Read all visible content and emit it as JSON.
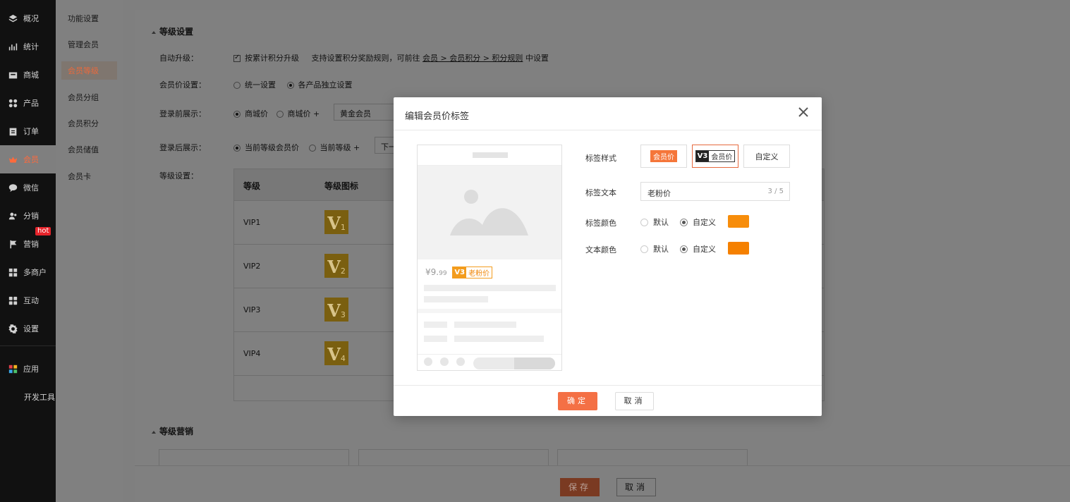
{
  "nav": {
    "items": [
      {
        "label": "概况",
        "icon": "layers-icon"
      },
      {
        "label": "统计",
        "icon": "chart-icon"
      },
      {
        "label": "商城",
        "icon": "store-icon"
      },
      {
        "label": "产品",
        "icon": "grid-icon"
      },
      {
        "label": "订单",
        "icon": "clipboard-icon"
      },
      {
        "label": "会员",
        "icon": "crown-icon",
        "active": true
      },
      {
        "label": "微信",
        "icon": "chat-icon"
      },
      {
        "label": "分销",
        "icon": "users-icon"
      },
      {
        "label": "营销",
        "icon": "flag-icon",
        "badge": "hot"
      },
      {
        "label": "多商户",
        "icon": "shop-icon"
      },
      {
        "label": "互动",
        "icon": "apps-icon"
      },
      {
        "label": "设置",
        "icon": "gear-icon"
      },
      {
        "label": "应用",
        "icon": "colorgrid-icon"
      },
      {
        "label": "开发工具",
        "icon": ""
      }
    ]
  },
  "submenu": {
    "items": [
      "功能设置",
      "管理会员",
      "会员等级",
      "会员分组",
      "会员积分",
      "会员储值",
      "会员卡"
    ],
    "active_index": 2
  },
  "main": {
    "level_settings_title": "等级设置",
    "auto_upgrade_label": "自动升级：",
    "auto_upgrade_option": "按累计积分升级",
    "auto_upgrade_hint": "支持设置积分奖励规则，可前往",
    "auto_upgrade_link": "会员 > 会员积分 > 积分规则",
    "auto_upgrade_hint_tail": "中设置",
    "member_price_label": "会员价设置：",
    "member_price_opt1": "统一设置",
    "member_price_opt2": "各产品独立设置",
    "before_login_label": "登录前展示：",
    "before_login_opt1": "商城价",
    "before_login_opt2": "商城价 +",
    "before_login_select": "黄金会员",
    "after_login_label": "登录后展示：",
    "after_login_opt1": "当前等级会员价",
    "after_login_opt2": "当前等级 +",
    "after_login_select": "下一",
    "levels_label": "等级设置：",
    "table_headers": [
      "等级",
      "等级图标"
    ],
    "levels": [
      {
        "name": "VIP1",
        "num": "1"
      },
      {
        "name": "VIP2",
        "num": "2"
      },
      {
        "name": "VIP3",
        "num": "3"
      },
      {
        "name": "VIP4",
        "num": "4"
      }
    ],
    "marketing_title": "等级营销",
    "save_label": "保存",
    "cancel_label": "取消"
  },
  "modal": {
    "title": "编辑会员价标签",
    "preview": {
      "price_symbol": "¥",
      "price_int": "9.",
      "price_dec": "99",
      "tag_level": "V3",
      "tag_text": "老粉价"
    },
    "style_label": "标签样式",
    "style_opt1": "会员价",
    "style_opt2_v": "V3",
    "style_opt2_text": "会员价",
    "style_opt3": "自定义",
    "text_label": "标签文本",
    "text_value": "老粉价",
    "text_count": "3 / 5",
    "tag_color_label": "标签颜色",
    "text_color_label": "文本颜色",
    "opt_default": "默认",
    "opt_custom": "自定义",
    "tag_color": "#f78d0b",
    "text_color": "#f58000",
    "ok_label": "确定",
    "cancel_label": "取消"
  }
}
